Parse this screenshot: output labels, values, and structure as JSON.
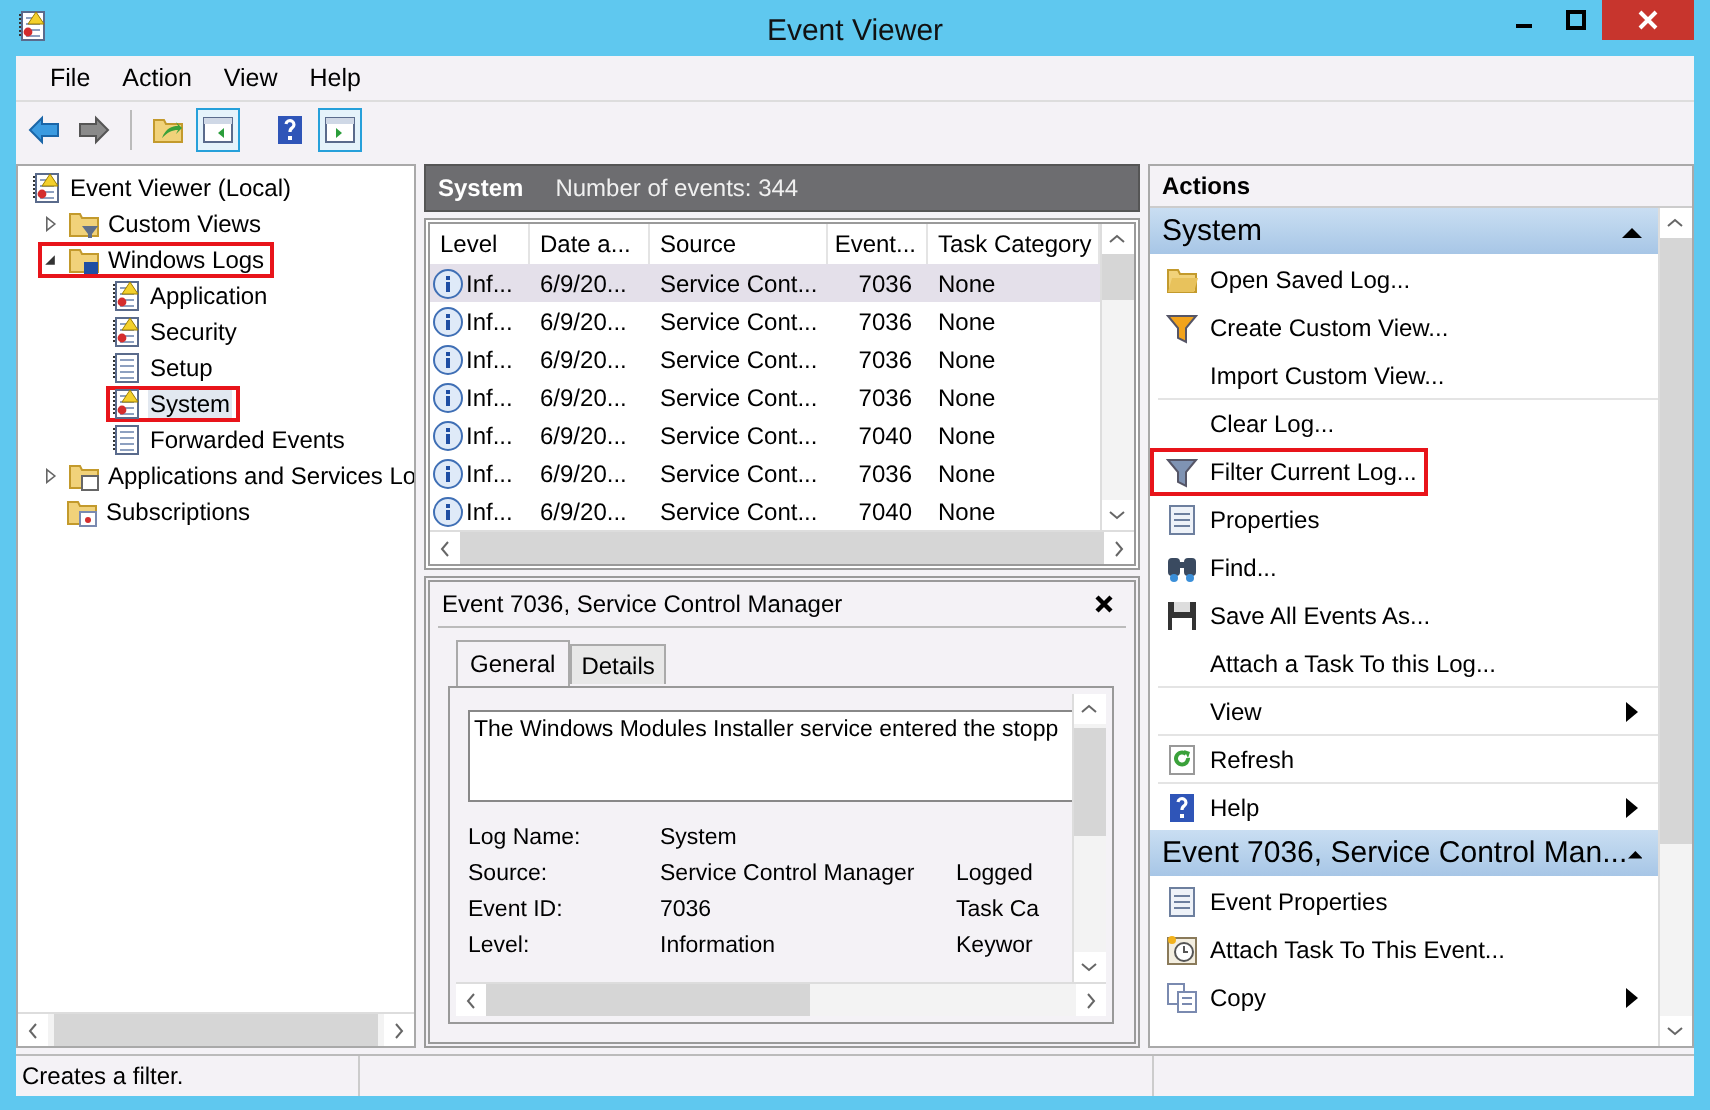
{
  "window": {
    "title": "Event Viewer"
  },
  "menu": [
    "File",
    "Action",
    "View",
    "Help"
  ],
  "toolbar": [
    {
      "kind": "back",
      "on": false
    },
    {
      "kind": "forward",
      "on": false
    },
    {
      "kind": "folder-arrow",
      "on": false
    },
    {
      "kind": "pane-left",
      "on": true
    },
    {
      "kind": "help",
      "on": false
    },
    {
      "kind": "pane-right",
      "on": true
    }
  ],
  "tree": {
    "label": "Event Viewer (Local)",
    "kind": "log-warning",
    "selected": false,
    "highlighted": false,
    "children": [
      {
        "label": "Custom Views",
        "kind": "folder-funnel",
        "expanded": false,
        "selected": false,
        "highlighted": false
      },
      {
        "label": "Windows Logs",
        "kind": "folder-logs",
        "expanded": true,
        "selected": false,
        "highlighted": true,
        "children": [
          {
            "label": "Application",
            "kind": "log-warning",
            "selected": false,
            "highlighted": false
          },
          {
            "label": "Security",
            "kind": "log-warning",
            "selected": false,
            "highlighted": false
          },
          {
            "label": "Setup",
            "kind": "log-plain",
            "selected": false,
            "highlighted": false
          },
          {
            "label": "System",
            "kind": "log-warning",
            "selected": true,
            "highlighted": true
          },
          {
            "label": "Forwarded Events",
            "kind": "log-plain",
            "selected": false,
            "highlighted": false
          }
        ]
      },
      {
        "label": "Applications and Services Lo",
        "kind": "folder-window",
        "expanded": false,
        "selected": false,
        "highlighted": false
      },
      {
        "label": "Subscriptions",
        "kind": "folder-subscriptions",
        "selected": false,
        "highlighted": false
      }
    ]
  },
  "log_header": {
    "title": "System",
    "count": "Number of events: 344"
  },
  "table": {
    "columns": [
      "Level",
      "Date a...",
      "Source",
      "Event...",
      "Task Category"
    ],
    "rows": [
      {
        "level": "Inf...",
        "date": "6/9/20...",
        "source": "Service Cont...",
        "event_id": "7036",
        "category": "None",
        "selected": true
      },
      {
        "level": "Inf...",
        "date": "6/9/20...",
        "source": "Service Cont...",
        "event_id": "7036",
        "category": "None",
        "selected": false
      },
      {
        "level": "Inf...",
        "date": "6/9/20...",
        "source": "Service Cont...",
        "event_id": "7036",
        "category": "None",
        "selected": false
      },
      {
        "level": "Inf...",
        "date": "6/9/20...",
        "source": "Service Cont...",
        "event_id": "7036",
        "category": "None",
        "selected": false
      },
      {
        "level": "Inf...",
        "date": "6/9/20...",
        "source": "Service Cont...",
        "event_id": "7040",
        "category": "None",
        "selected": false
      },
      {
        "level": "Inf...",
        "date": "6/9/20...",
        "source": "Service Cont...",
        "event_id": "7036",
        "category": "None",
        "selected": false
      },
      {
        "level": "Inf...",
        "date": "6/9/20...",
        "source": "Service Cont...",
        "event_id": "7040",
        "category": "None",
        "selected": false
      }
    ]
  },
  "detail": {
    "title": "Event 7036, Service Control Manager",
    "tabs": [
      {
        "label": "General",
        "selected": true
      },
      {
        "label": "Details",
        "selected": false
      }
    ],
    "message": "The Windows Modules Installer service entered the stopp",
    "fields": [
      {
        "label": "Log Name:",
        "value": "System"
      },
      {
        "label": "Source:",
        "value": "Service Control Manager",
        "column_3": "Logged"
      },
      {
        "label": "Event ID:",
        "value": "7036",
        "column_3": "Task Ca"
      },
      {
        "label": "Level:",
        "value": "Information",
        "column_3": "Keywor"
      }
    ]
  },
  "actions": {
    "title": "Actions",
    "sections": [
      {
        "title": "System",
        "expanded": true,
        "items": [
          {
            "label": "Open Saved Log...",
            "kind": "folder-open",
            "submenu": false,
            "divider_above": false,
            "highlighted": false
          },
          {
            "label": "Create Custom View...",
            "kind": "funnel-orange",
            "submenu": false,
            "divider_above": false,
            "highlighted": false
          },
          {
            "label": "Import Custom View...",
            "kind": "plain",
            "submenu": false,
            "divider_above": false,
            "highlighted": false
          },
          {
            "label": "Clear Log...",
            "kind": "plain",
            "submenu": false,
            "divider_above": true,
            "highlighted": false
          },
          {
            "label": "Filter Current Log...",
            "kind": "funnel-blue",
            "submenu": false,
            "divider_above": false,
            "highlighted": true
          },
          {
            "label": "Properties",
            "kind": "properties",
            "submenu": false,
            "divider_above": false,
            "highlighted": false
          },
          {
            "label": "Find...",
            "kind": "binoculars",
            "submenu": false,
            "divider_above": false,
            "highlighted": false
          },
          {
            "label": "Save All Events As...",
            "kind": "floppy",
            "submenu": false,
            "divider_above": false,
            "highlighted": false
          },
          {
            "label": "Attach a Task To this Log...",
            "kind": "plain",
            "submenu": false,
            "divider_above": false,
            "highlighted": false
          },
          {
            "label": "View",
            "kind": "plain",
            "submenu": true,
            "divider_above": true,
            "highlighted": false
          },
          {
            "label": "Refresh",
            "kind": "refresh",
            "submenu": false,
            "divider_above": true,
            "highlighted": false
          },
          {
            "label": "Help",
            "kind": "help",
            "submenu": true,
            "divider_above": true,
            "highlighted": false
          }
        ]
      },
      {
        "title": "Event 7036, Service Control Man...",
        "expanded": true,
        "items": [
          {
            "label": "Event Properties",
            "kind": "properties",
            "submenu": false,
            "divider_above": false,
            "highlighted": false
          },
          {
            "label": "Attach Task To This Event...",
            "kind": "clock",
            "submenu": false,
            "divider_above": false,
            "highlighted": false
          },
          {
            "label": "Copy",
            "kind": "copy",
            "submenu": true,
            "divider_above": false,
            "highlighted": false
          }
        ]
      }
    ]
  },
  "status_bar": {
    "text": "Creates a filter."
  }
}
